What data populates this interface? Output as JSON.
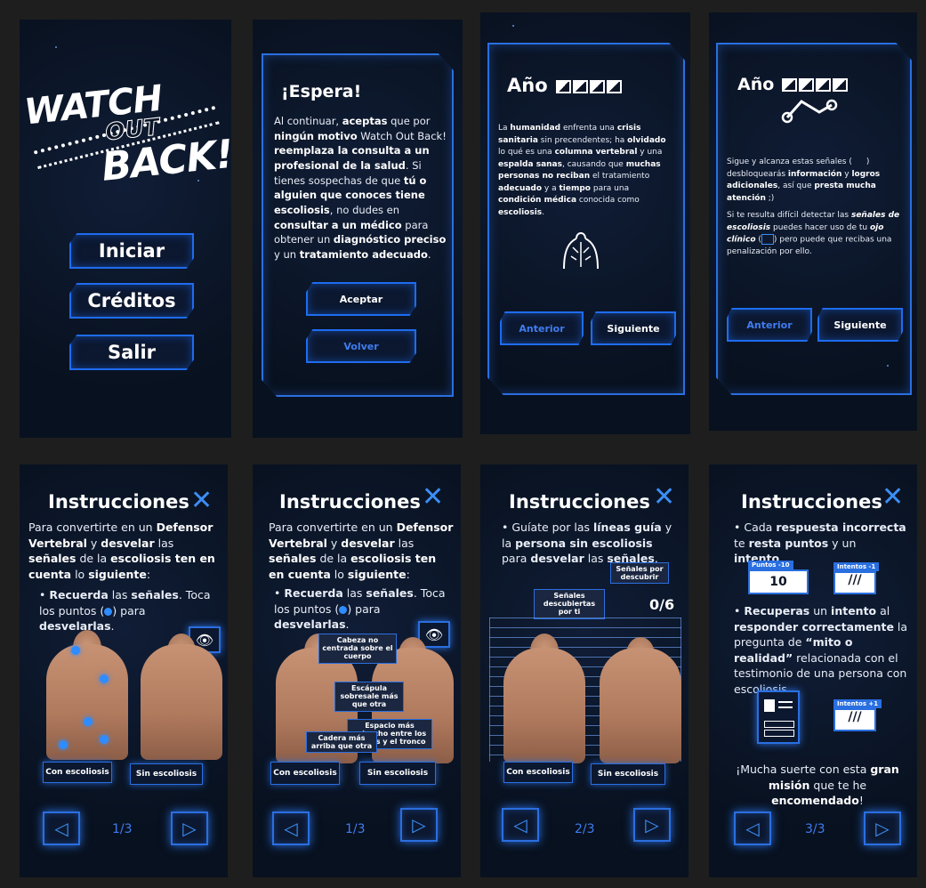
{
  "menu": {
    "logo": {
      "line1": "WATCH",
      "line2": "OUT",
      "line3": "BACK!"
    },
    "buttons": [
      "Iniciar",
      "Créditos",
      "Salir"
    ]
  },
  "espera": {
    "title": "¡Espera!",
    "text_parts": [
      "Al continuar, ",
      "aceptas",
      " que por ",
      "ningún motivo",
      " Watch Out Back! ",
      "reemplaza la consulta a un profesional de la salud",
      ". Si tienes sospechas de que ",
      "tú o alguien que conoces tiene escoliosis",
      ", no dudes en ",
      "consultar a un médico",
      " para obtener un ",
      "diagnóstico preciso",
      " y un ",
      "tratamiento adecuado",
      "."
    ],
    "accept_label": "Aceptar",
    "back_label": "Volver"
  },
  "year1": {
    "title": "Año",
    "text_parts": [
      "La ",
      "humanidad",
      " enfrenta una ",
      "crisis sanitaria",
      " sin precendentes; ha ",
      "olvidado",
      " lo qué es una ",
      "columna vertebral",
      " y una ",
      "espalda sanas",
      ", causando que ",
      "muchas personas no reciban",
      " el tratamiento ",
      "adecuado",
      " y a ",
      "tiempo",
      " para una ",
      "condición médica",
      " conocida como ",
      "escoliosis",
      "."
    ],
    "prev_label": "Anterior",
    "next_label": "Siguiente"
  },
  "year2": {
    "title": "Año",
    "p1_parts": [
      "Sigue y alcanza estas señales (",
      "     ",
      ") desbloquearás ",
      "información",
      " y ",
      "logros adicionales",
      ", así que ",
      "presta mucha atención",
      " ;)"
    ],
    "p2_parts": [
      "Si te resulta difícil detectar las ",
      "señales de escoliosis",
      " puedes hacer uso de tu ",
      "ojo clínico",
      " (",
      "   ",
      ") pero puede que recibas una penalización por ello."
    ],
    "prev_label": "Anterior",
    "next_label": "Siguiente"
  },
  "instructions": {
    "title": "Instrucciones",
    "close": "✕",
    "intro_parts": [
      "Para convertirte en un ",
      "Defensor Vertebral",
      " y ",
      "desvelar",
      " las ",
      "señales",
      " de la ",
      "escoliosis ten en cuenta",
      " lo ",
      "siguiente",
      ":"
    ],
    "bullet1_parts": [
      "Recuerda",
      " las ",
      "señales",
      ". Toca los puntos (",
      "  ",
      ") para ",
      "desvelarlas",
      "."
    ],
    "with_label": "Con escoliosis",
    "without_label": "Sin escoliosis",
    "callouts": [
      "Cabeza no centrada sobre el cuerpo",
      "Escápula sobresale más que otra",
      "Espacio más estrecho entre los brazos y el tronco",
      "Cadera más arriba que otra"
    ],
    "page3_bullet_parts": [
      "Guíate por las ",
      "líneas guía",
      " y la ",
      "persona sin escoliosis",
      " para ",
      "desvelar",
      " las ",
      "señales",
      "."
    ],
    "signals_to_discover": "Señales por descubrir",
    "signals_discovered": "Señales descubiertas por ti",
    "counter": "0/6",
    "page4_b1_parts": [
      "Cada ",
      "respuesta incorrecta",
      " te ",
      "resta puntos",
      " y un ",
      "intento",
      "."
    ],
    "points_tag": "Puntos      -10",
    "points_value": "10",
    "attempts_tag": "Intentos -1",
    "attempts_tag2": "Intentos +1",
    "page4_b2_parts": [
      "Recuperas",
      " un ",
      "intento",
      " al ",
      "responder correctamente",
      " la pregunta de ",
      "“mito o realidad”",
      " relacionada con el testimonio de una persona con escoliosis."
    ],
    "luck_parts": [
      "¡Mucha suerte con esta ",
      "gran misión",
      " que te he ",
      "encomendado",
      "!"
    ],
    "pages": [
      "1/3",
      "1/3",
      "2/3",
      "3/3"
    ]
  }
}
